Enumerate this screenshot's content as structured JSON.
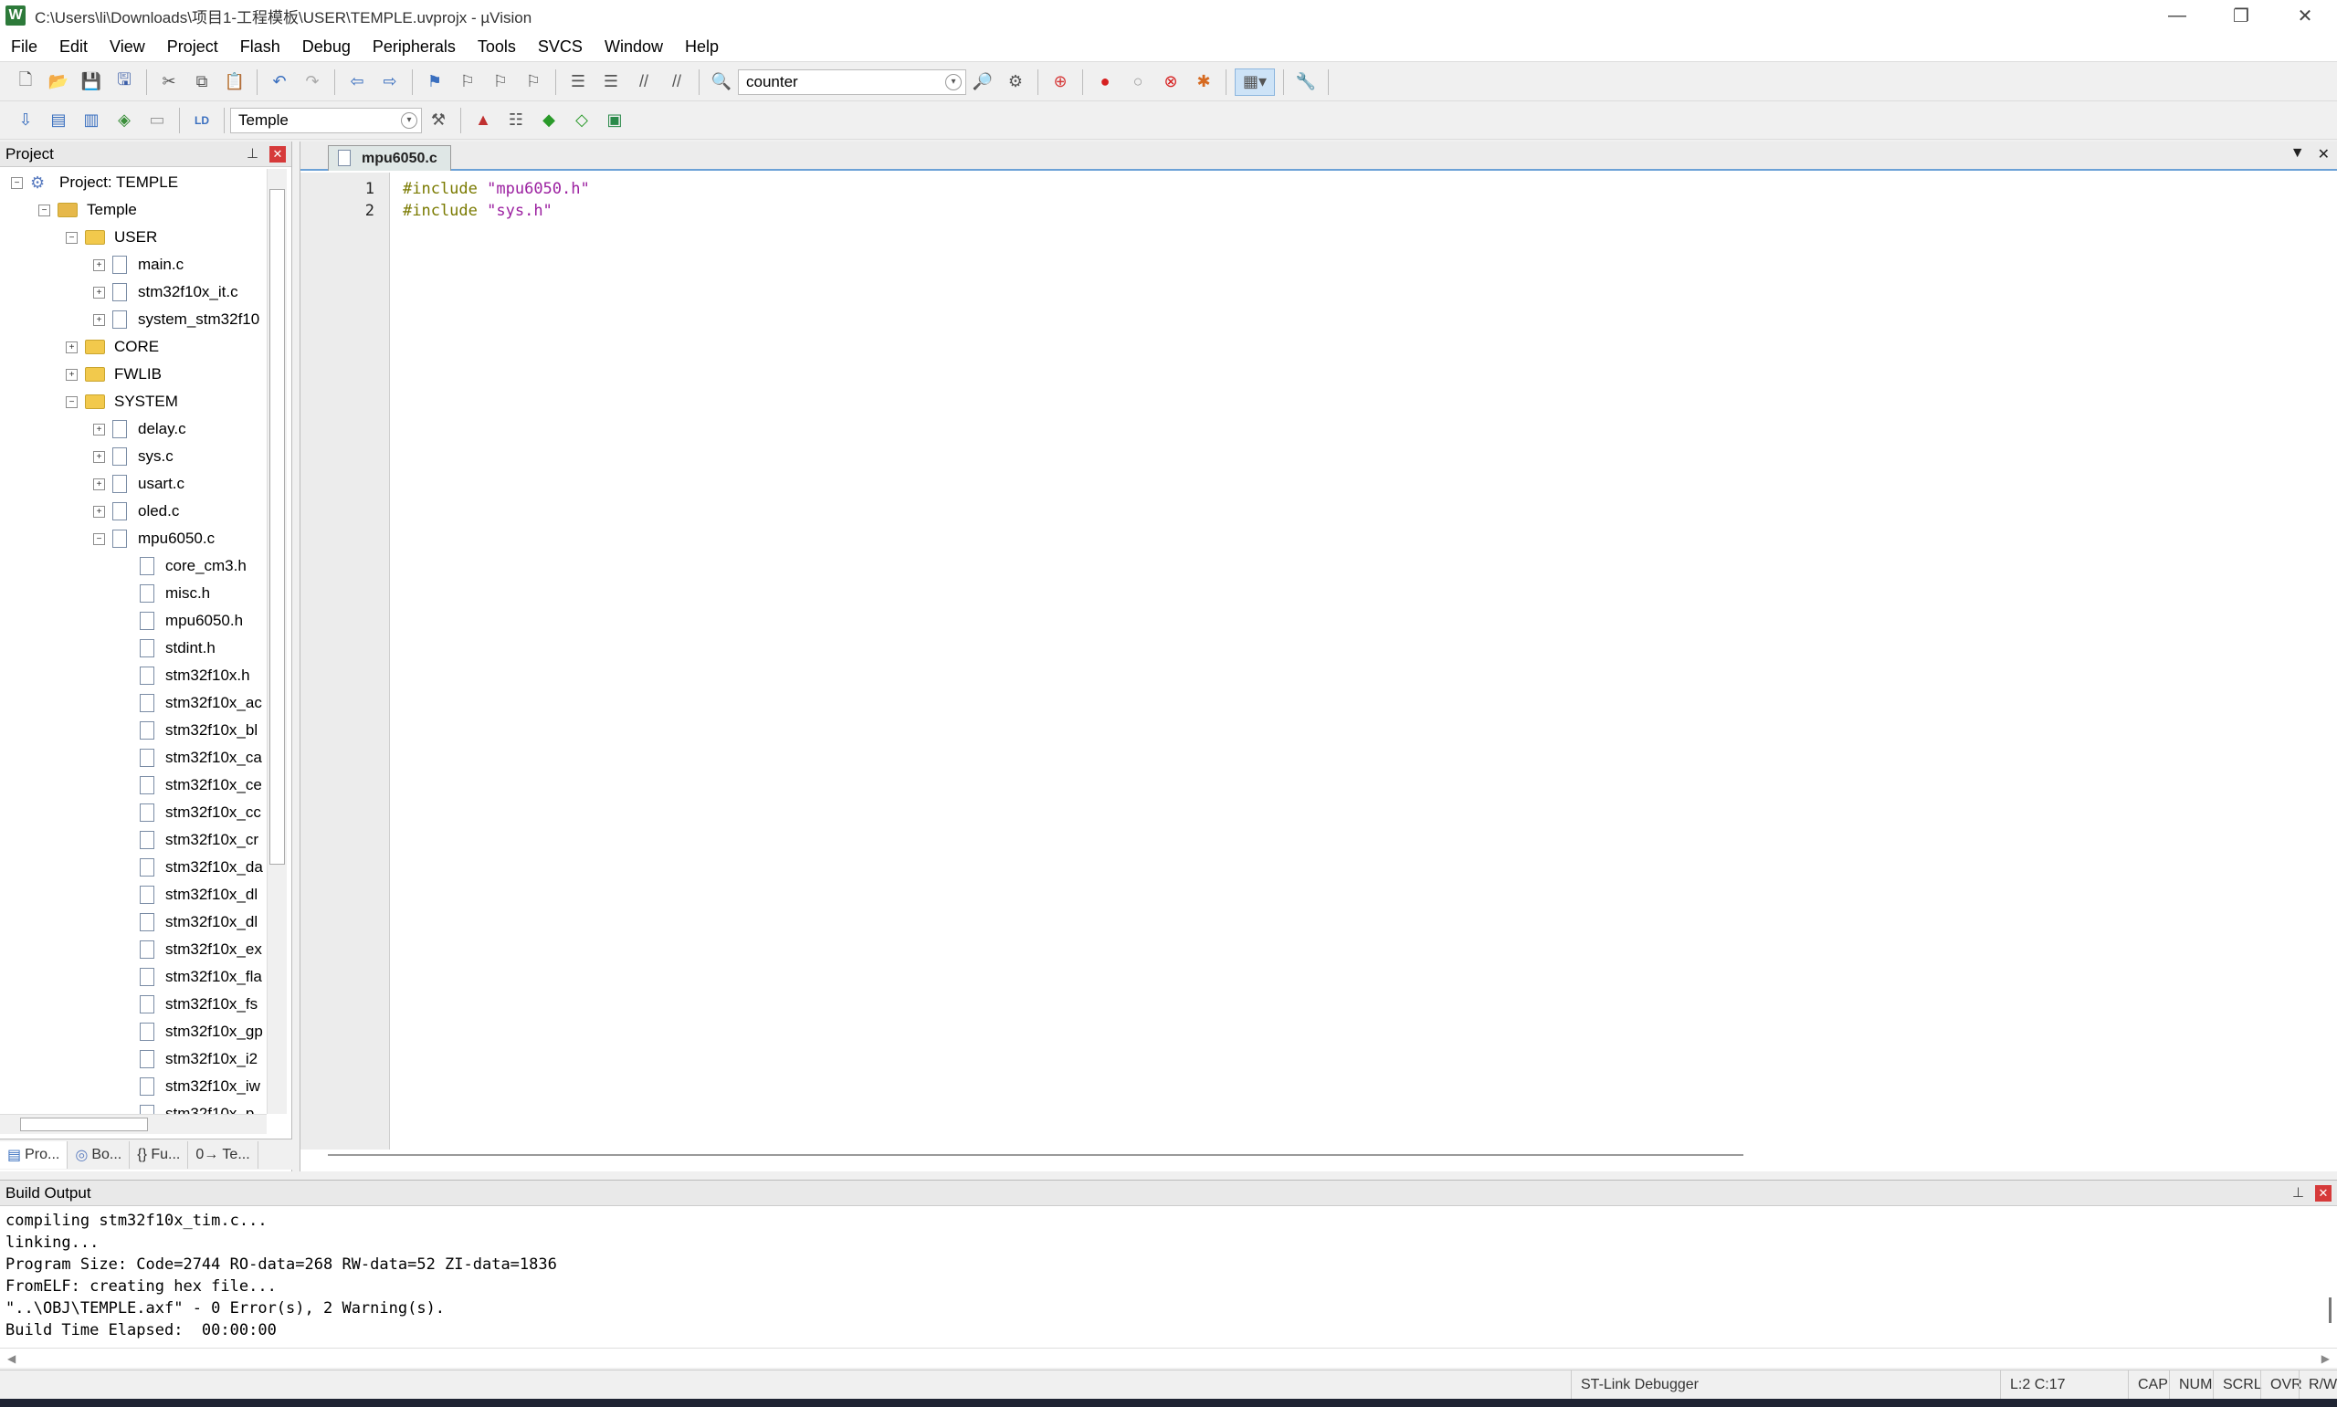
{
  "window": {
    "title": "C:\\Users\\li\\Downloads\\项目1-工程模板\\USER\\TEMPLE.uvprojx - µVision",
    "app_icon": "W",
    "minimize": "—",
    "restore": "❐",
    "close": "✕"
  },
  "menu": [
    "File",
    "Edit",
    "View",
    "Project",
    "Flash",
    "Debug",
    "Peripherals",
    "Tools",
    "SVCS",
    "Window",
    "Help"
  ],
  "toolbar": {
    "find_value": "counter",
    "target_value": "Temple"
  },
  "project_panel": {
    "title": "Project",
    "tree": [
      {
        "label": "Project: TEMPLE",
        "level": 0,
        "toggle": "−",
        "icon": "project-icon"
      },
      {
        "label": "Temple",
        "level": 1,
        "toggle": "−",
        "icon": "target-folder-icon"
      },
      {
        "label": "USER",
        "level": 2,
        "toggle": "−",
        "icon": "folder-icon"
      },
      {
        "label": "main.c",
        "level": 3,
        "toggle": "+",
        "icon": "file-icon"
      },
      {
        "label": "stm32f10x_it.c",
        "level": 3,
        "toggle": "+",
        "icon": "file-icon"
      },
      {
        "label": "system_stm32f10",
        "level": 3,
        "toggle": "+",
        "icon": "file-icon"
      },
      {
        "label": "CORE",
        "level": 2,
        "toggle": "+",
        "icon": "folder-icon"
      },
      {
        "label": "FWLIB",
        "level": 2,
        "toggle": "+",
        "icon": "folder-icon"
      },
      {
        "label": "SYSTEM",
        "level": 2,
        "toggle": "−",
        "icon": "folder-icon"
      },
      {
        "label": "delay.c",
        "level": 3,
        "toggle": "+",
        "icon": "file-icon"
      },
      {
        "label": "sys.c",
        "level": 3,
        "toggle": "+",
        "icon": "file-icon"
      },
      {
        "label": "usart.c",
        "level": 3,
        "toggle": "+",
        "icon": "file-icon"
      },
      {
        "label": "oled.c",
        "level": 3,
        "toggle": "+",
        "icon": "file-icon"
      },
      {
        "label": "mpu6050.c",
        "level": 3,
        "toggle": "−",
        "icon": "file-icon"
      },
      {
        "label": "core_cm3.h",
        "level": 4,
        "toggle": "",
        "icon": "file-icon"
      },
      {
        "label": "misc.h",
        "level": 4,
        "toggle": "",
        "icon": "file-icon"
      },
      {
        "label": "mpu6050.h",
        "level": 4,
        "toggle": "",
        "icon": "file-icon"
      },
      {
        "label": "stdint.h",
        "level": 4,
        "toggle": "",
        "icon": "file-icon"
      },
      {
        "label": "stm32f10x.h",
        "level": 4,
        "toggle": "",
        "icon": "file-icon"
      },
      {
        "label": "stm32f10x_ac",
        "level": 4,
        "toggle": "",
        "icon": "file-icon"
      },
      {
        "label": "stm32f10x_bl",
        "level": 4,
        "toggle": "",
        "icon": "file-icon"
      },
      {
        "label": "stm32f10x_ca",
        "level": 4,
        "toggle": "",
        "icon": "file-icon"
      },
      {
        "label": "stm32f10x_ce",
        "level": 4,
        "toggle": "",
        "icon": "file-icon"
      },
      {
        "label": "stm32f10x_cc",
        "level": 4,
        "toggle": "",
        "icon": "file-icon"
      },
      {
        "label": "stm32f10x_cr",
        "level": 4,
        "toggle": "",
        "icon": "file-icon"
      },
      {
        "label": "stm32f10x_da",
        "level": 4,
        "toggle": "",
        "icon": "file-icon"
      },
      {
        "label": "stm32f10x_dl",
        "level": 4,
        "toggle": "",
        "icon": "file-icon"
      },
      {
        "label": "stm32f10x_dl",
        "level": 4,
        "toggle": "",
        "icon": "file-icon"
      },
      {
        "label": "stm32f10x_ex",
        "level": 4,
        "toggle": "",
        "icon": "file-icon"
      },
      {
        "label": "stm32f10x_fla",
        "level": 4,
        "toggle": "",
        "icon": "file-icon"
      },
      {
        "label": "stm32f10x_fs",
        "level": 4,
        "toggle": "",
        "icon": "file-icon"
      },
      {
        "label": "stm32f10x_gp",
        "level": 4,
        "toggle": "",
        "icon": "file-icon"
      },
      {
        "label": "stm32f10x_i2",
        "level": 4,
        "toggle": "",
        "icon": "file-icon"
      },
      {
        "label": "stm32f10x_iw",
        "level": 4,
        "toggle": "",
        "icon": "file-icon"
      },
      {
        "label": "stm32f10x_p",
        "level": 4,
        "toggle": "",
        "icon": "file-icon"
      }
    ],
    "tabs": [
      "Pro...",
      "Bo...",
      "{} Fu...",
      "0→ Te..."
    ]
  },
  "editor": {
    "active_tab": "mpu6050.c",
    "lines": [
      {
        "num": "1",
        "kw": "#include",
        "str": "\"mpu6050.h\""
      },
      {
        "num": "2",
        "kw": "#include",
        "str": "\"sys.h\""
      }
    ]
  },
  "build_output": {
    "title": "Build Output",
    "lines": [
      "compiling stm32f10x_tim.c...",
      "linking...",
      "Program Size: Code=2744 RO-data=268 RW-data=52 ZI-data=1836",
      "FromELF: creating hex file...",
      "\"..\\OBJ\\TEMPLE.axf\" - 0 Error(s), 2 Warning(s).",
      "Build Time Elapsed:  00:00:00"
    ]
  },
  "status": {
    "debugger": "ST-Link Debugger",
    "position": "L:2 C:17",
    "cap": "CAP",
    "num": "NUM",
    "scrl": "SCRL",
    "ovr": "OVR",
    "rw": "R/W"
  },
  "colors": {
    "keyword": "#7a7a00",
    "string": "#9b1fa0",
    "tab_accent": "#6ba1d6",
    "close_red": "#d63a3a"
  }
}
